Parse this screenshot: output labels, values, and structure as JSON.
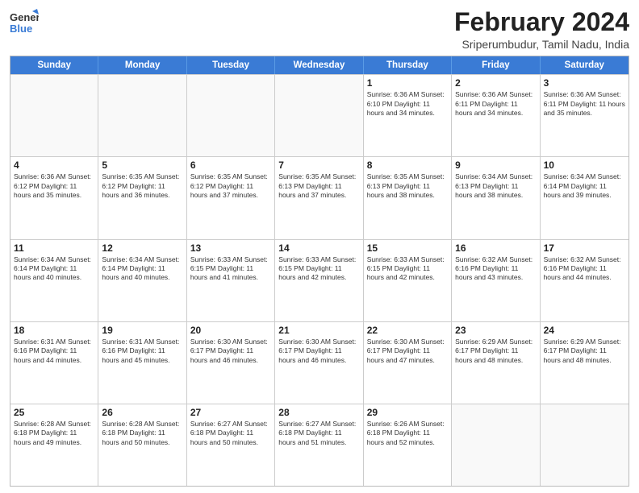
{
  "header": {
    "logo_line1": "General",
    "logo_line2": "Blue",
    "title": "February 2024",
    "subtitle": "Sriperumbudur, Tamil Nadu, India"
  },
  "days_of_week": [
    "Sunday",
    "Monday",
    "Tuesday",
    "Wednesday",
    "Thursday",
    "Friday",
    "Saturday"
  ],
  "weeks": [
    [
      {
        "day": "",
        "info": ""
      },
      {
        "day": "",
        "info": ""
      },
      {
        "day": "",
        "info": ""
      },
      {
        "day": "",
        "info": ""
      },
      {
        "day": "1",
        "info": "Sunrise: 6:36 AM\nSunset: 6:10 PM\nDaylight: 11 hours\nand 34 minutes."
      },
      {
        "day": "2",
        "info": "Sunrise: 6:36 AM\nSunset: 6:11 PM\nDaylight: 11 hours\nand 34 minutes."
      },
      {
        "day": "3",
        "info": "Sunrise: 6:36 AM\nSunset: 6:11 PM\nDaylight: 11 hours\nand 35 minutes."
      }
    ],
    [
      {
        "day": "4",
        "info": "Sunrise: 6:36 AM\nSunset: 6:12 PM\nDaylight: 11 hours\nand 35 minutes."
      },
      {
        "day": "5",
        "info": "Sunrise: 6:35 AM\nSunset: 6:12 PM\nDaylight: 11 hours\nand 36 minutes."
      },
      {
        "day": "6",
        "info": "Sunrise: 6:35 AM\nSunset: 6:12 PM\nDaylight: 11 hours\nand 37 minutes."
      },
      {
        "day": "7",
        "info": "Sunrise: 6:35 AM\nSunset: 6:13 PM\nDaylight: 11 hours\nand 37 minutes."
      },
      {
        "day": "8",
        "info": "Sunrise: 6:35 AM\nSunset: 6:13 PM\nDaylight: 11 hours\nand 38 minutes."
      },
      {
        "day": "9",
        "info": "Sunrise: 6:34 AM\nSunset: 6:13 PM\nDaylight: 11 hours\nand 38 minutes."
      },
      {
        "day": "10",
        "info": "Sunrise: 6:34 AM\nSunset: 6:14 PM\nDaylight: 11 hours\nand 39 minutes."
      }
    ],
    [
      {
        "day": "11",
        "info": "Sunrise: 6:34 AM\nSunset: 6:14 PM\nDaylight: 11 hours\nand 40 minutes."
      },
      {
        "day": "12",
        "info": "Sunrise: 6:34 AM\nSunset: 6:14 PM\nDaylight: 11 hours\nand 40 minutes."
      },
      {
        "day": "13",
        "info": "Sunrise: 6:33 AM\nSunset: 6:15 PM\nDaylight: 11 hours\nand 41 minutes."
      },
      {
        "day": "14",
        "info": "Sunrise: 6:33 AM\nSunset: 6:15 PM\nDaylight: 11 hours\nand 42 minutes."
      },
      {
        "day": "15",
        "info": "Sunrise: 6:33 AM\nSunset: 6:15 PM\nDaylight: 11 hours\nand 42 minutes."
      },
      {
        "day": "16",
        "info": "Sunrise: 6:32 AM\nSunset: 6:16 PM\nDaylight: 11 hours\nand 43 minutes."
      },
      {
        "day": "17",
        "info": "Sunrise: 6:32 AM\nSunset: 6:16 PM\nDaylight: 11 hours\nand 44 minutes."
      }
    ],
    [
      {
        "day": "18",
        "info": "Sunrise: 6:31 AM\nSunset: 6:16 PM\nDaylight: 11 hours\nand 44 minutes."
      },
      {
        "day": "19",
        "info": "Sunrise: 6:31 AM\nSunset: 6:16 PM\nDaylight: 11 hours\nand 45 minutes."
      },
      {
        "day": "20",
        "info": "Sunrise: 6:30 AM\nSunset: 6:17 PM\nDaylight: 11 hours\nand 46 minutes."
      },
      {
        "day": "21",
        "info": "Sunrise: 6:30 AM\nSunset: 6:17 PM\nDaylight: 11 hours\nand 46 minutes."
      },
      {
        "day": "22",
        "info": "Sunrise: 6:30 AM\nSunset: 6:17 PM\nDaylight: 11 hours\nand 47 minutes."
      },
      {
        "day": "23",
        "info": "Sunrise: 6:29 AM\nSunset: 6:17 PM\nDaylight: 11 hours\nand 48 minutes."
      },
      {
        "day": "24",
        "info": "Sunrise: 6:29 AM\nSunset: 6:17 PM\nDaylight: 11 hours\nand 48 minutes."
      }
    ],
    [
      {
        "day": "25",
        "info": "Sunrise: 6:28 AM\nSunset: 6:18 PM\nDaylight: 11 hours\nand 49 minutes."
      },
      {
        "day": "26",
        "info": "Sunrise: 6:28 AM\nSunset: 6:18 PM\nDaylight: 11 hours\nand 50 minutes."
      },
      {
        "day": "27",
        "info": "Sunrise: 6:27 AM\nSunset: 6:18 PM\nDaylight: 11 hours\nand 50 minutes."
      },
      {
        "day": "28",
        "info": "Sunrise: 6:27 AM\nSunset: 6:18 PM\nDaylight: 11 hours\nand 51 minutes."
      },
      {
        "day": "29",
        "info": "Sunrise: 6:26 AM\nSunset: 6:18 PM\nDaylight: 11 hours\nand 52 minutes."
      },
      {
        "day": "",
        "info": ""
      },
      {
        "day": "",
        "info": ""
      }
    ]
  ]
}
